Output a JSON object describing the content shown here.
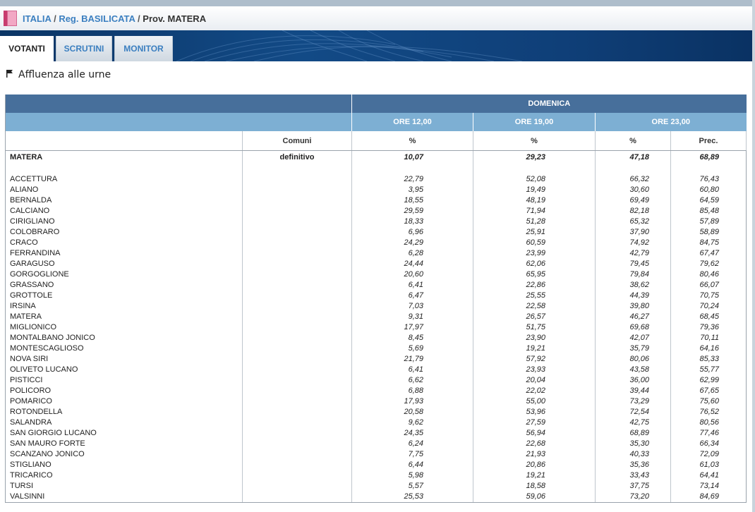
{
  "breadcrumb": {
    "country": "ITALIA",
    "separator": "/",
    "region": "Reg. BASILICATA",
    "province": "Prov. MATERA"
  },
  "tabs": [
    {
      "label": "VOTANTI",
      "active": true
    },
    {
      "label": "SCRUTINI",
      "active": false
    },
    {
      "label": "MONITOR",
      "active": false
    }
  ],
  "section": {
    "title": "Affluenza alle urne",
    "icon": "flag-icon"
  },
  "table": {
    "day": "DOMENICA",
    "times": [
      "ORE 12,00",
      "ORE 19,00",
      "ORE 23,00"
    ],
    "columns": {
      "comuni": "Comuni",
      "pct": "%",
      "prec": "Prec."
    },
    "total": {
      "name": "MATERA",
      "status": "definitivo",
      "v12": "10,07",
      "v19": "29,23",
      "v23": "47,18",
      "prec": "68,89"
    },
    "rows": [
      {
        "name": "ACCETTURA",
        "v12": "22,79",
        "v19": "52,08",
        "v23": "66,32",
        "prec": "76,43"
      },
      {
        "name": "ALIANO",
        "v12": "3,95",
        "v19": "19,49",
        "v23": "30,60",
        "prec": "60,80"
      },
      {
        "name": "BERNALDA",
        "v12": "18,55",
        "v19": "48,19",
        "v23": "69,49",
        "prec": "64,59"
      },
      {
        "name": "CALCIANO",
        "v12": "29,59",
        "v19": "71,94",
        "v23": "82,18",
        "prec": "85,48"
      },
      {
        "name": "CIRIGLIANO",
        "v12": "18,33",
        "v19": "51,28",
        "v23": "65,32",
        "prec": "57,89"
      },
      {
        "name": "COLOBRARO",
        "v12": "6,96",
        "v19": "25,91",
        "v23": "37,90",
        "prec": "58,89"
      },
      {
        "name": "CRACO",
        "v12": "24,29",
        "v19": "60,59",
        "v23": "74,92",
        "prec": "84,75"
      },
      {
        "name": "FERRANDINA",
        "v12": "6,28",
        "v19": "23,99",
        "v23": "42,79",
        "prec": "67,47"
      },
      {
        "name": "GARAGUSO",
        "v12": "24,44",
        "v19": "62,06",
        "v23": "79,45",
        "prec": "79,62"
      },
      {
        "name": "GORGOGLIONE",
        "v12": "20,60",
        "v19": "65,95",
        "v23": "79,84",
        "prec": "80,46"
      },
      {
        "name": "GRASSANO",
        "v12": "6,41",
        "v19": "22,86",
        "v23": "38,62",
        "prec": "66,07"
      },
      {
        "name": "GROTTOLE",
        "v12": "6,47",
        "v19": "25,55",
        "v23": "44,39",
        "prec": "70,75"
      },
      {
        "name": "IRSINA",
        "v12": "7,03",
        "v19": "22,58",
        "v23": "39,80",
        "prec": "70,24"
      },
      {
        "name": "MATERA",
        "v12": "9,31",
        "v19": "26,57",
        "v23": "46,27",
        "prec": "68,45"
      },
      {
        "name": "MIGLIONICO",
        "v12": "17,97",
        "v19": "51,75",
        "v23": "69,68",
        "prec": "79,36"
      },
      {
        "name": "MONTALBANO JONICO",
        "v12": "8,45",
        "v19": "23,90",
        "v23": "42,07",
        "prec": "70,11"
      },
      {
        "name": "MONTESCAGLIOSO",
        "v12": "5,69",
        "v19": "19,21",
        "v23": "35,79",
        "prec": "64,16"
      },
      {
        "name": "NOVA SIRI",
        "v12": "21,79",
        "v19": "57,92",
        "v23": "80,06",
        "prec": "85,33"
      },
      {
        "name": "OLIVETO LUCANO",
        "v12": "6,41",
        "v19": "23,93",
        "v23": "43,58",
        "prec": "55,77"
      },
      {
        "name": "PISTICCI",
        "v12": "6,62",
        "v19": "20,04",
        "v23": "36,00",
        "prec": "62,99"
      },
      {
        "name": "POLICORO",
        "v12": "6,88",
        "v19": "22,02",
        "v23": "39,44",
        "prec": "67,65"
      },
      {
        "name": "POMARICO",
        "v12": "17,93",
        "v19": "55,00",
        "v23": "73,29",
        "prec": "75,60"
      },
      {
        "name": "ROTONDELLA",
        "v12": "20,58",
        "v19": "53,96",
        "v23": "72,54",
        "prec": "76,52"
      },
      {
        "name": "SALANDRA",
        "v12": "9,62",
        "v19": "27,59",
        "v23": "42,75",
        "prec": "80,56"
      },
      {
        "name": "SAN GIORGIO LUCANO",
        "v12": "24,35",
        "v19": "56,94",
        "v23": "68,89",
        "prec": "77,46"
      },
      {
        "name": "SAN MAURO FORTE",
        "v12": "6,24",
        "v19": "22,68",
        "v23": "35,30",
        "prec": "66,34"
      },
      {
        "name": "SCANZANO JONICO",
        "v12": "7,75",
        "v19": "21,93",
        "v23": "40,33",
        "prec": "72,09"
      },
      {
        "name": "STIGLIANO",
        "v12": "6,44",
        "v19": "20,86",
        "v23": "35,36",
        "prec": "61,03"
      },
      {
        "name": "TRICARICO",
        "v12": "5,98",
        "v19": "19,21",
        "v23": "33,43",
        "prec": "64,41"
      },
      {
        "name": "TURSI",
        "v12": "5,57",
        "v19": "18,58",
        "v23": "37,75",
        "prec": "73,14"
      },
      {
        "name": "VALSINNI",
        "v12": "25,53",
        "v19": "59,06",
        "v23": "73,20",
        "prec": "84,69"
      }
    ]
  }
}
